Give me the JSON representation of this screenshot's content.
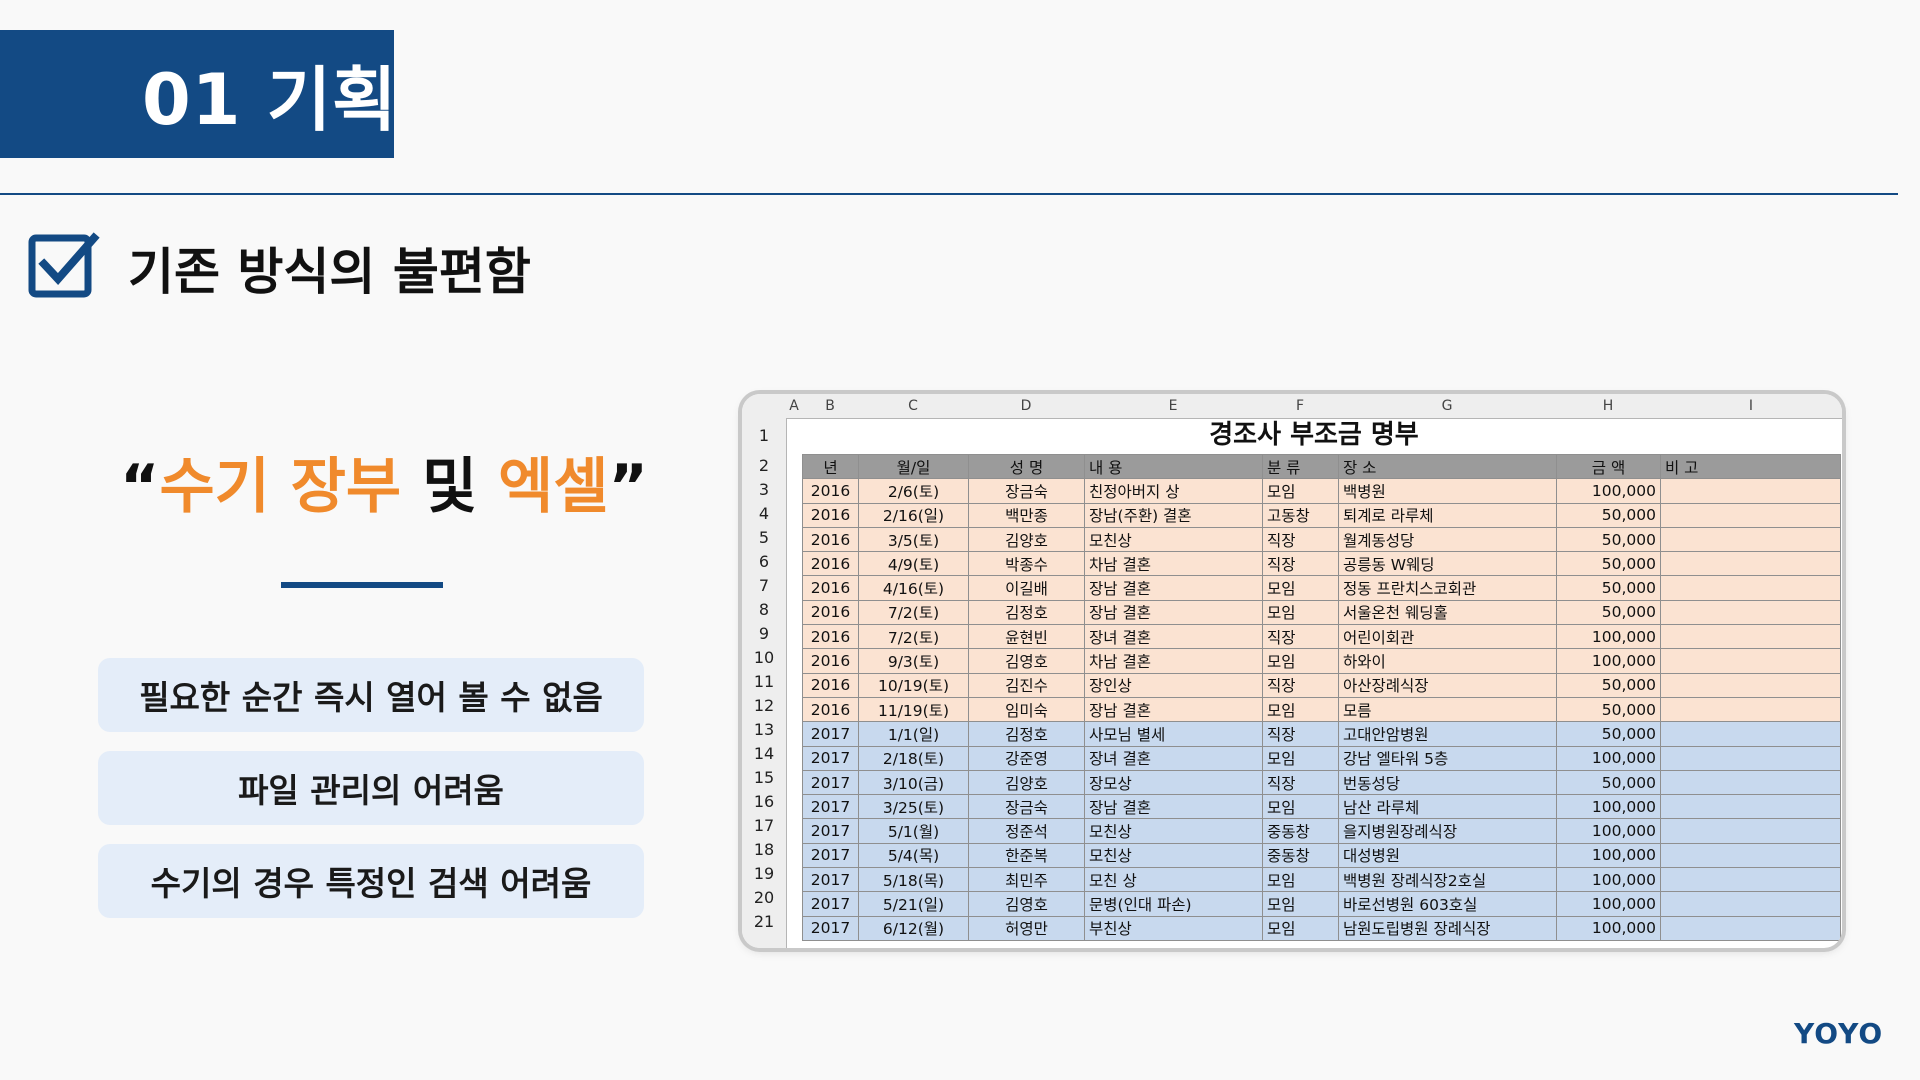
{
  "slide": {
    "section_title": "01 기획",
    "subtitle": "기존 방식의 불편함",
    "quote": {
      "open": "“",
      "part1": "수기 장부",
      "middle": " 및 ",
      "part2": "엑셀",
      "close": "”"
    },
    "points": [
      "필요한 순간 즉시 열어 볼 수 없음",
      "파일 관리의 어려움",
      "수기의 경우 특정인 검색 어려움"
    ],
    "brand": "YOYO",
    "colors": {
      "navy": "#134a84",
      "orange": "#f08a2c",
      "pill": "#e4edf9"
    }
  },
  "spreadsheet": {
    "column_letters": [
      "A",
      "B",
      "C",
      "D",
      "E",
      "F",
      "G",
      "H",
      "I"
    ],
    "row_numbers": [
      "1",
      "2",
      "3",
      "4",
      "5",
      "6",
      "7",
      "8",
      "9",
      "10",
      "11",
      "12",
      "13",
      "14",
      "15",
      "16",
      "17",
      "18",
      "19",
      "20",
      "21"
    ],
    "title": "경조사 부조금 명부",
    "headers": [
      "년",
      "월/일",
      "성 명",
      "내 용",
      "분 류",
      "장 소",
      "금 액",
      "비 고"
    ],
    "rows": [
      [
        "2016",
        "2/6(토)",
        "장금숙",
        "친정아버지 상",
        "모임",
        "백병원",
        "100,000",
        ""
      ],
      [
        "2016",
        "2/16(일)",
        "백만종",
        "장남(주환) 결혼",
        "고동창",
        "퇴계로 라루체",
        "50,000",
        ""
      ],
      [
        "2016",
        "3/5(토)",
        "김양호",
        "모친상",
        "직장",
        "월계동성당",
        "50,000",
        ""
      ],
      [
        "2016",
        "4/9(토)",
        "박종수",
        "차남 결혼",
        "직장",
        "공릉동 W웨딩",
        "50,000",
        ""
      ],
      [
        "2016",
        "4/16(토)",
        "이길배",
        "장남 결혼",
        "모임",
        "정동 프란치스코회관",
        "50,000",
        ""
      ],
      [
        "2016",
        "7/2(토)",
        "김정호",
        "장남 결혼",
        "모임",
        "서울온천 웨딩홀",
        "50,000",
        ""
      ],
      [
        "2016",
        "7/2(토)",
        "윤현빈",
        "장녀 결혼",
        "직장",
        "어린이회관",
        "100,000",
        ""
      ],
      [
        "2016",
        "9/3(토)",
        "김영호",
        "차남 결혼",
        "모임",
        "하와이",
        "100,000",
        ""
      ],
      [
        "2016",
        "10/19(토)",
        "김진수",
        "장인상",
        "직장",
        "아산장례식장",
        "50,000",
        ""
      ],
      [
        "2016",
        "11/19(토)",
        "임미숙",
        "장남 결혼",
        "모임",
        "모름",
        "50,000",
        ""
      ],
      [
        "2017",
        "1/1(일)",
        "김정호",
        "사모님 별세",
        "직장",
        "고대안암병원",
        "50,000",
        ""
      ],
      [
        "2017",
        "2/18(토)",
        "강준영",
        "장녀 결혼",
        "모임",
        "강남 엘타워 5층",
        "100,000",
        ""
      ],
      [
        "2017",
        "3/10(금)",
        "김양호",
        "장모상",
        "직장",
        "번동성당",
        "50,000",
        ""
      ],
      [
        "2017",
        "3/25(토)",
        "장금숙",
        "장남 결혼",
        "모임",
        "남산 라루체",
        "100,000",
        ""
      ],
      [
        "2017",
        "5/1(월)",
        "정준석",
        "모친상",
        "중동창",
        "을지병원장례식장",
        "100,000",
        ""
      ],
      [
        "2017",
        "5/4(목)",
        "한준복",
        "모친상",
        "중동창",
        "대성병원",
        "100,000",
        ""
      ],
      [
        "2017",
        "5/18(목)",
        "최민주",
        "모친 상",
        "모임",
        "백병원 장례식장2호실",
        "100,000",
        ""
      ],
      [
        "2017",
        "5/21(일)",
        "김영호",
        "문병(인대 파손)",
        "모임",
        "바로선병원 603호실",
        "100,000",
        ""
      ],
      [
        "2017",
        "6/12(월)",
        "허영만",
        "부친상",
        "모임",
        "남원도립병원 장례식장",
        "100,000",
        ""
      ]
    ]
  }
}
